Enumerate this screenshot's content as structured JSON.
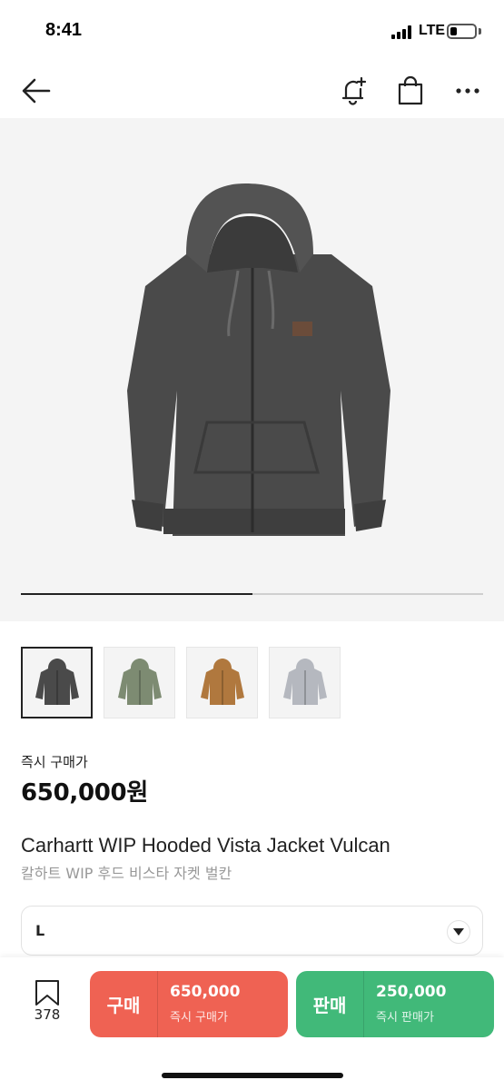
{
  "status_bar": {
    "time": "8:41",
    "network": "LTE",
    "icons": [
      "signal-icon",
      "battery-icon"
    ]
  },
  "nav": {
    "icons": [
      "back-arrow-icon",
      "bell-plus-icon",
      "shopping-bag-icon",
      "more-dots-icon"
    ]
  },
  "gallery": {
    "main_image": "charcoal-hooded-jacket",
    "progress": 0.5,
    "thumbnails": [
      {
        "color_name": "charcoal",
        "color": "#4a4a4a",
        "selected": true
      },
      {
        "color_name": "olive",
        "color": "#7d8b72",
        "selected": false
      },
      {
        "color_name": "tan",
        "color": "#b0783e",
        "selected": false
      },
      {
        "color_name": "grey",
        "color": "#b5b8bf",
        "selected": false
      }
    ]
  },
  "product": {
    "price_label": "즉시 구매가",
    "price": "650,000원",
    "title_en": "Carhartt WIP Hooded Vista Jacket Vulcan",
    "title_ko": "칼하트 WIP 후드 비스타 자켓 벌칸"
  },
  "size_selector": {
    "value": "L"
  },
  "bottom_bar": {
    "bookmark_count": "378",
    "buy": {
      "label": "구매",
      "price": "650,000",
      "sub_label": "즉시 구매가",
      "color": "#ef6253"
    },
    "sell": {
      "label": "판매",
      "price": "250,000",
      "sub_label": "즉시 판매가",
      "color": "#41b979"
    }
  }
}
